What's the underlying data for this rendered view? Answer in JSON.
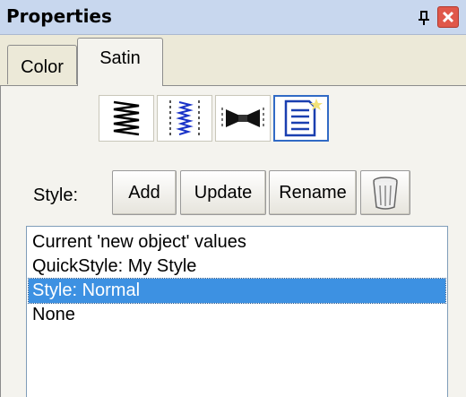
{
  "panel": {
    "title": "Properties"
  },
  "tabs": [
    {
      "label": "Color",
      "selected": false
    },
    {
      "label": "Satin",
      "selected": true
    }
  ],
  "mode_buttons": [
    {
      "icon": "zigzag-satin-icon",
      "active": false
    },
    {
      "icon": "wavy-satin-icon",
      "active": false
    },
    {
      "icon": "bowtie-satin-icon",
      "active": false
    },
    {
      "icon": "document-properties-icon",
      "active": true
    }
  ],
  "style_row": {
    "label": "Style:",
    "add_label": "Add",
    "update_label": "Update",
    "rename_label": "Rename",
    "delete_icon": "trash-icon"
  },
  "style_list": {
    "items": [
      "Current 'new object' values",
      "QuickStyle: My Style",
      "Style: Normal",
      "None"
    ],
    "selected": "Style: Normal"
  },
  "colors": {
    "selection": "#3d91e2",
    "titlebar": "#c8d7ee",
    "close_button": "#e0584a"
  }
}
